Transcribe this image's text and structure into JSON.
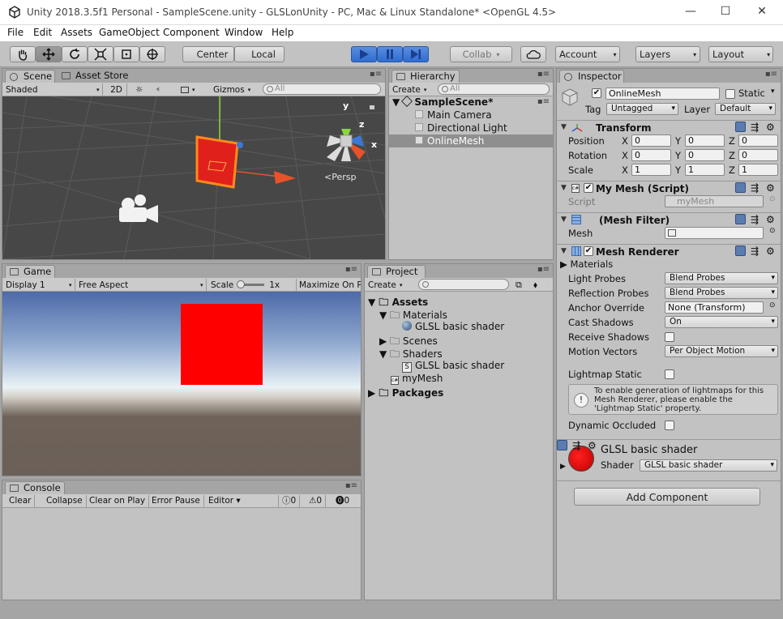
{
  "window": {
    "title": "Unity 2018.3.5f1 Personal - SampleScene.unity - GLSLonUnity - PC, Mac & Linux Standalone* <OpenGL 4.5>"
  },
  "menu": [
    "File",
    "Edit",
    "Assets",
    "GameObject",
    "Component",
    "Window",
    "Help"
  ],
  "toolbar": {
    "center": "Center",
    "local": "Local",
    "collab": "Collab",
    "account": "Account",
    "layers": "Layers",
    "layout": "Layout"
  },
  "scene": {
    "tabs": [
      "Scene",
      "Asset Store"
    ],
    "shading": "Shaded",
    "mode2d": "2D",
    "gizmos": "Gizmos",
    "search_placeholder": "All",
    "axes": {
      "y": "y",
      "x": "x",
      "z": "z"
    },
    "persp": "<Persp"
  },
  "hierarchy": {
    "tab": "Hierarchy",
    "create": "Create",
    "search_placeholder": "All",
    "scene": "SampleScene*",
    "items": [
      "Main Camera",
      "Directional Light",
      "OnlineMesh"
    ]
  },
  "game": {
    "tab": "Game",
    "display": "Display 1",
    "aspect": "Free Aspect",
    "scale_label": "Scale",
    "scale_value": "1x",
    "maximize": "Maximize On Pl"
  },
  "project": {
    "tab": "Project",
    "create": "Create",
    "assets": "Assets",
    "materials": "Materials",
    "material_item": "GLSL basic shader",
    "scenes": "Scenes",
    "shaders": "Shaders",
    "shader_item": "GLSL basic shader",
    "script": "myMesh",
    "packages": "Packages"
  },
  "console": {
    "tab": "Console",
    "buttons": [
      "Clear",
      "Collapse",
      "Clear on Play",
      "Error Pause",
      "Editor"
    ],
    "counts": [
      "0",
      "0",
      "0"
    ]
  },
  "inspector": {
    "tab": "Inspector",
    "name": "OnlineMesh",
    "static": "Static",
    "tag_label": "Tag",
    "tag": "Untagged",
    "layer_label": "Layer",
    "layer": "Default",
    "transform": {
      "title": "Transform",
      "rows": [
        {
          "label": "Position",
          "x": "0",
          "y": "0",
          "z": "0"
        },
        {
          "label": "Rotation",
          "x": "0",
          "y": "0",
          "z": "0"
        },
        {
          "label": "Scale",
          "x": "1",
          "y": "1",
          "z": "1"
        }
      ],
      "axis": [
        "X",
        "Y",
        "Z"
      ]
    },
    "script": {
      "title": "My Mesh (Script)",
      "label": "Script",
      "value": "myMesh"
    },
    "mesh_filter": {
      "title": "(Mesh Filter)",
      "label": "Mesh"
    },
    "renderer": {
      "title": "Mesh Renderer",
      "materials": "Materials",
      "light_probes_label": "Light Probes",
      "light_probes": "Blend Probes",
      "reflection_probes_label": "Reflection Probes",
      "reflection_probes": "Blend Probes",
      "anchor_label": "Anchor Override",
      "anchor": "None (Transform)",
      "cast_label": "Cast Shadows",
      "cast": "On",
      "receive_label": "Receive Shadows",
      "motion_label": "Motion Vectors",
      "motion": "Per Object Motion",
      "lightmap_label": "Lightmap Static",
      "info": "To enable generation of lightmaps for this Mesh Renderer, please enable the 'Lightmap Static' property.",
      "occluded_label": "Dynamic Occluded"
    },
    "material": {
      "title": "GLSL basic shader",
      "shader_label": "Shader",
      "shader": "GLSL basic shader"
    },
    "add_component": "Add Component"
  },
  "colors": {
    "accent_blue": "#3a78d8",
    "selection": "#8f8f8f",
    "red": "#ff0000"
  }
}
